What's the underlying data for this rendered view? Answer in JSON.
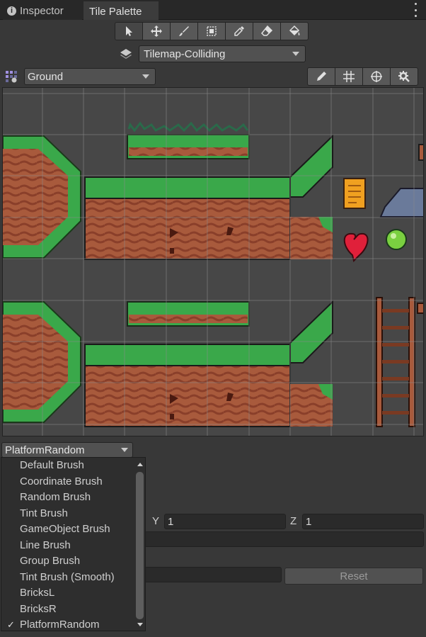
{
  "tabs": [
    {
      "label": "Inspector",
      "icon": "info-icon"
    },
    {
      "label": "Tile Palette"
    }
  ],
  "tools": [
    "select-tool",
    "move-tool",
    "paint-brush-tool",
    "box-fill-tool",
    "picker-tool",
    "eraser-tool",
    "flood-fill-tool"
  ],
  "active_tilemap": "Tilemap-Colliding",
  "palette": "Ground",
  "edit_tools": [
    "edit-pencil-icon",
    "grid-toggle-icon",
    "gizmo-icon",
    "settings-gear-icon"
  ],
  "brush": {
    "selected": "PlatformRandom",
    "options": [
      "Default Brush",
      "Coordinate Brush",
      "Random Brush",
      "Tint Brush",
      "GameObject Brush",
      "Line Brush",
      "Group Brush",
      "Tint Brush (Smooth)",
      "BricksL",
      "BricksR",
      "PlatformRandom"
    ]
  },
  "fields": {
    "y_label": "Y",
    "y_value": "1",
    "z_label": "Z",
    "z_value": "1",
    "reset_label": "Reset"
  },
  "colors": {
    "grass": "#3aa84a",
    "dirt": "#a85a3c",
    "grid_bg": "#474747"
  }
}
